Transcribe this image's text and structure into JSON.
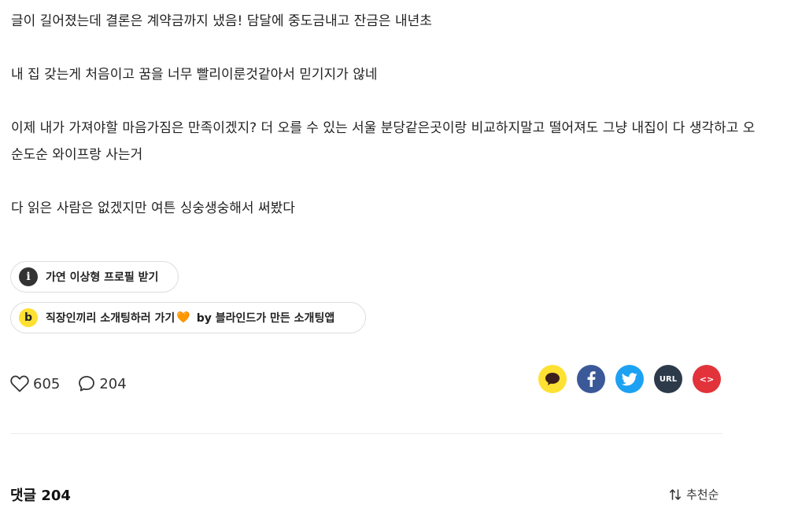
{
  "post": {
    "paragraphs": [
      "글이 길어졌는데 결론은 계약금까지 냈음! 담달에 중도금내고 잔금은 내년초",
      "내 집 갖는게 처음이고 꿈을 너무 빨리이룬것같아서 믿기지가 않네",
      "이제 내가 가져야할 마음가짐은 만족이겠지? 더 오를 수 있는 서울 분당같은곳이랑 비교하지말고 떨어져도 그냥 내집이 다 생각하고 오순도순 와이프랑 사는거",
      "다 읽은 사람은 없겠지만 여튼 싱숭생숭해서 써봤다"
    ]
  },
  "chips": {
    "profile": {
      "icon": "info-icon",
      "label": "가연 이상형 프로필 받기"
    },
    "blind": {
      "icon": "blind-b-icon",
      "icon_text": "b",
      "label": "직장인끼리 소개팅하러 가기",
      "emoji": "🧡",
      "suffix": "by 블라인드가 만든 소개팅앱"
    }
  },
  "stats": {
    "likes": "605",
    "comments": "204"
  },
  "share": {
    "url_label": "URL",
    "embed_label": "<>",
    "colors": {
      "kakao": "#fee133",
      "facebook": "#3b5998",
      "twitter": "#1da1f2",
      "url": "#2d3a4a",
      "embed": "#e2333b"
    }
  },
  "comments_section": {
    "title": "댓글 204",
    "sort_label": "추천순"
  }
}
